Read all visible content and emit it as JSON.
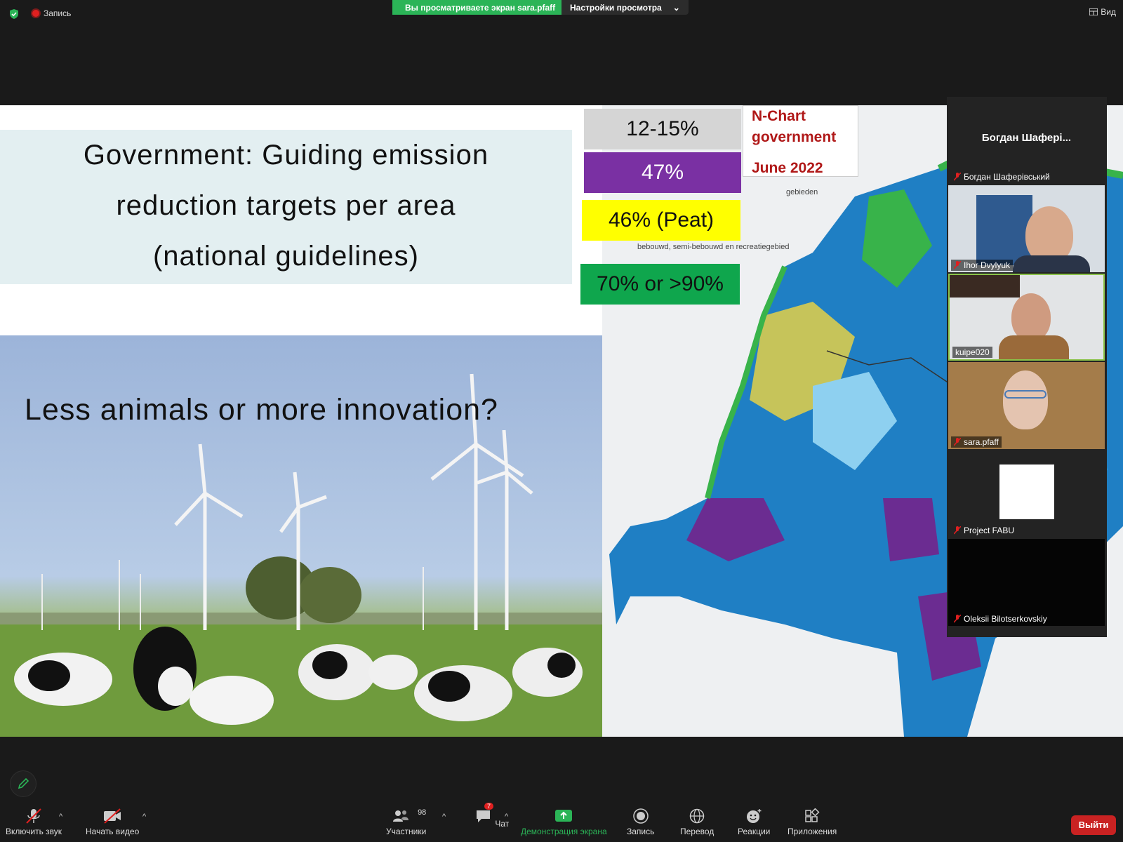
{
  "topbar": {
    "recording": "Запись",
    "viewing_banner": "Вы просматриваете экран sara.pfaff",
    "view_settings": "Настройки просмотра",
    "view_button": "Вид"
  },
  "slide": {
    "title_lines": [
      "Government: Guiding emission",
      "reduction targets  per area",
      "(national guidelines)"
    ],
    "question": "Less animals or more innovation?",
    "chips": [
      "12-15%",
      "47%",
      "46% (Peat)",
      "70% or >90%"
    ],
    "ncharts": {
      "line1": "N-Chart",
      "line2": "government",
      "date": "June 2022"
    },
    "legend": {
      "a": "gebieden",
      "b": "bebouwd, semi-bebouwd en recreatiegebied"
    }
  },
  "gallery": {
    "top_tile_name": "Богдан  Шафері...",
    "participants": [
      {
        "name": "Богдан Шаферівський",
        "muted": true
      },
      {
        "name": "Ihor Dvylyuk",
        "muted": true
      },
      {
        "name": "kuipe020",
        "muted": false
      },
      {
        "name": "sara.pfaff",
        "muted": true
      },
      {
        "name": "Project FABU",
        "muted": true
      },
      {
        "name": "Oleksii Bilotserkovskiy",
        "muted": true
      }
    ]
  },
  "toolbar": {
    "mic": "Включить звук",
    "video": "Начать видео",
    "participants": "Участники",
    "participants_count": "98",
    "chat": "Чат",
    "chat_badge": "7",
    "share": "Демонстрация экрана",
    "record": "Запись",
    "translate": "Перевод",
    "reactions": "Реакции",
    "apps": "Приложения",
    "leave": "Выйти"
  },
  "colors": {
    "accent_green": "#2bb457",
    "leave_red": "#c92222",
    "purple": "#7a30a3",
    "yellow": "#ffff00"
  }
}
